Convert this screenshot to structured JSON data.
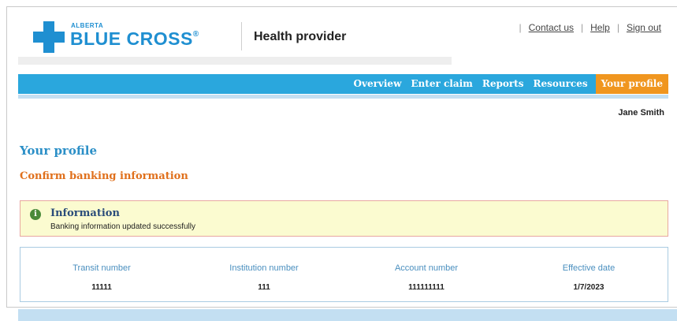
{
  "header": {
    "logo_top": "ALBERTA",
    "logo_brand": "BLUE CROSS",
    "logo_reg": "®",
    "subtitle": "Health provider"
  },
  "toplinks": {
    "contact": "Contact us",
    "help": "Help",
    "signout": "Sign out"
  },
  "nav": {
    "items": [
      {
        "label": "Overview"
      },
      {
        "label": "Enter claim"
      },
      {
        "label": "Reports"
      },
      {
        "label": "Resources"
      },
      {
        "label": "Your profile",
        "active": true
      }
    ]
  },
  "user": {
    "name": "Jane Smith"
  },
  "page": {
    "title": "Your profile",
    "subtitle": "Confirm banking information"
  },
  "info": {
    "icon_glyph": "i",
    "title": "Information",
    "message": "Banking information updated successfully"
  },
  "banking": {
    "columns": [
      {
        "label": "Transit number",
        "value": "11111"
      },
      {
        "label": "Institution number",
        "value": "111"
      },
      {
        "label": "Account number",
        "value": "111111111"
      },
      {
        "label": "Effective date",
        "value": "1/7/2023"
      }
    ]
  },
  "colors": {
    "brand_blue": "#1f8fd1",
    "nav_blue": "#2aa7dd",
    "nav_active": "#f0961f",
    "title_blue": "#2b8fc7",
    "subtitle_orange": "#e0701c",
    "info_bg": "#fbfbd0"
  }
}
